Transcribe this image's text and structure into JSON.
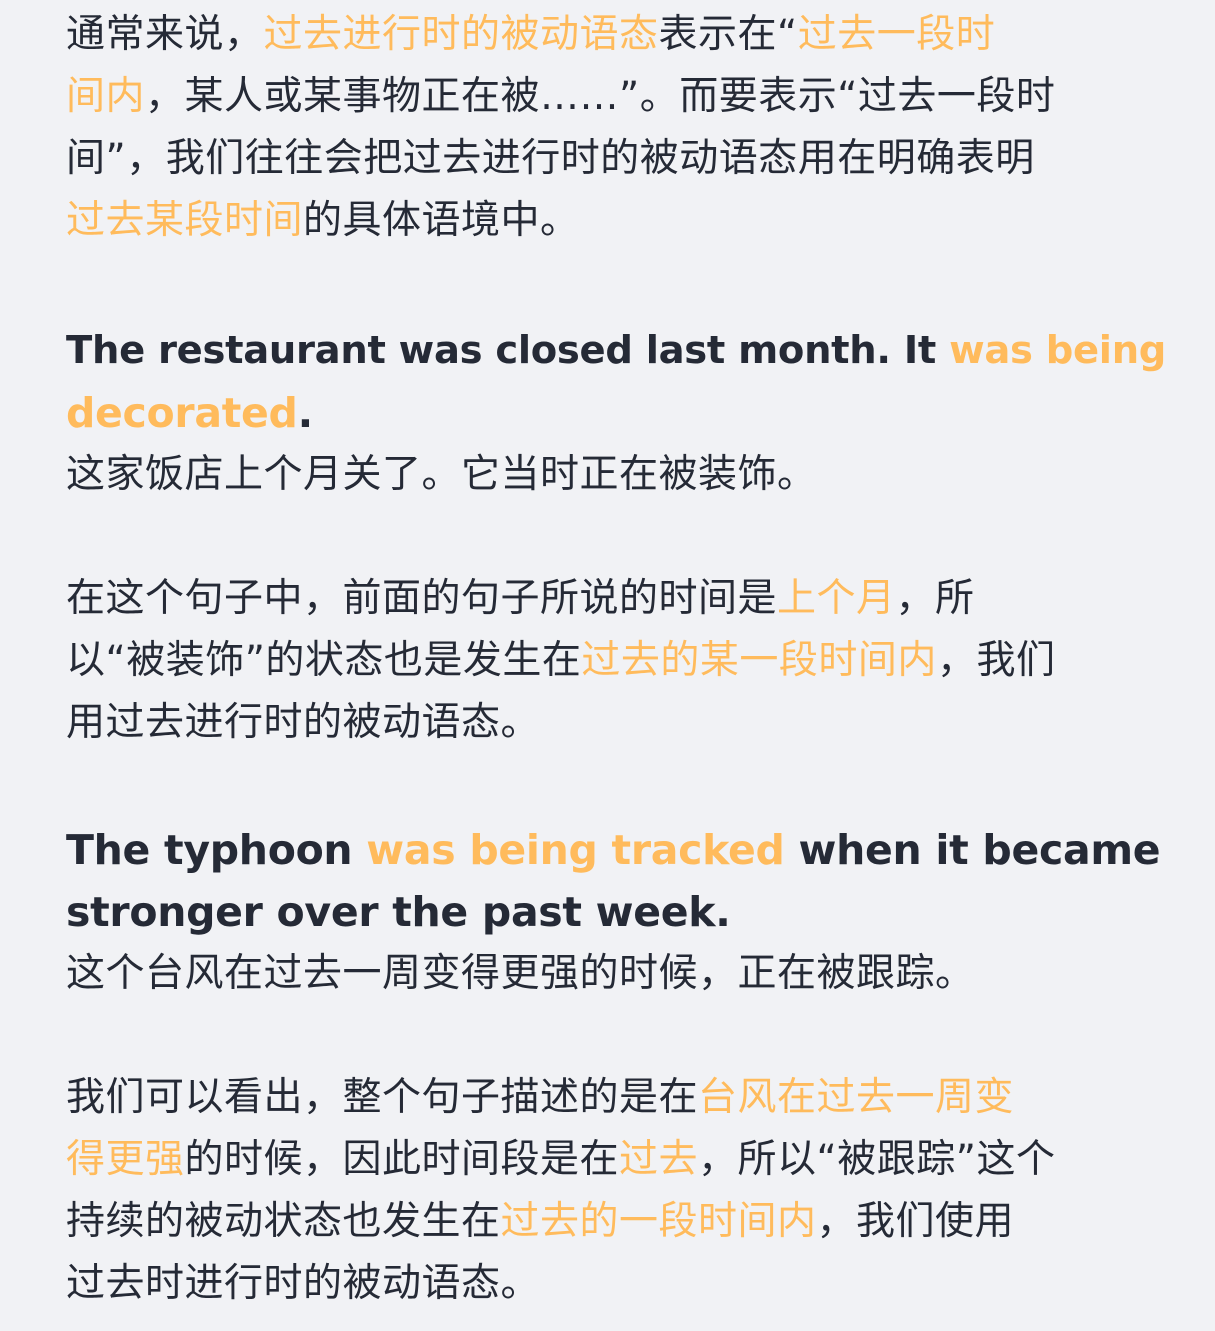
{
  "paragraphs": [
    {
      "type": "explanation",
      "lines": [
        [
          {
            "text": "通常来说，",
            "highlight": false
          },
          {
            "text": "过去进行时的被动语态",
            "highlight": true
          },
          {
            "text": "表示在“",
            "highlight": false
          },
          {
            "text": "过去一段时",
            "highlight": true
          }
        ],
        [
          {
            "text": "间内",
            "highlight": true
          },
          {
            "text": "，某人或某事物正在被……”。而要表示“过去一段时",
            "highlight": false
          }
        ],
        [
          {
            "text": "间”，我们往往会把过去进行时的被动语态用在明确表明",
            "highlight": false
          }
        ],
        [
          {
            "text": "过去某段时间",
            "highlight": true
          },
          {
            "text": "的具体语境中。",
            "highlight": false
          }
        ]
      ]
    },
    {
      "type": "example",
      "lines": [
        [
          {
            "text": "The restaurant was closed last month. It ",
            "highlight": false
          },
          {
            "text": "was being",
            "highlight": true
          }
        ],
        [
          {
            "text": "decorated",
            "highlight": true
          },
          {
            "text": ".",
            "highlight": false
          }
        ]
      ],
      "translation": "这家饭店上个月关了。它当时正在被装饰。"
    },
    {
      "type": "explanation",
      "lines": [
        [
          {
            "text": "在这个句子中，前面的句子所说的时间是",
            "highlight": false
          },
          {
            "text": "上个月",
            "highlight": true
          },
          {
            "text": "，所",
            "highlight": false
          }
        ],
        [
          {
            "text": "以“被装饰”的状态也是发生在",
            "highlight": false
          },
          {
            "text": "过去的某一段时间内",
            "highlight": true
          },
          {
            "text": "，我们",
            "highlight": false
          }
        ],
        [
          {
            "text": "用过去进行时的被动语态。",
            "highlight": false
          }
        ]
      ]
    },
    {
      "type": "example",
      "lines": [
        [
          {
            "text": "The typhoon ",
            "highlight": false
          },
          {
            "text": "was being tracked",
            "highlight": true
          },
          {
            "text": " when it became",
            "highlight": false
          }
        ],
        [
          {
            "text": "stronger over the past week.",
            "highlight": false
          }
        ]
      ],
      "translation": "这个台风在过去一周变得更强的时候，正在被跟踪。"
    },
    {
      "type": "explanation",
      "lines": [
        [
          {
            "text": "我们可以看出，整个句子描述的是在",
            "highlight": false
          },
          {
            "text": "台风在过去一周变",
            "highlight": true
          }
        ],
        [
          {
            "text": "得更强",
            "highlight": true
          },
          {
            "text": "的时候，因此时间段是在",
            "highlight": false
          },
          {
            "text": "过去",
            "highlight": true
          },
          {
            "text": "，所以“被跟踪”这个",
            "highlight": false
          }
        ],
        [
          {
            "text": "持续的被动状态也发生在",
            "highlight": false
          },
          {
            "text": "过去的一段时间内",
            "highlight": true
          },
          {
            "text": "，我们使用",
            "highlight": false
          }
        ],
        [
          {
            "text": "过去时进行时的被动语态。",
            "highlight": false
          }
        ]
      ]
    }
  ],
  "colors": {
    "text": "#252a36",
    "highlight": "#ffbb5c",
    "background": "#f1f2f5"
  }
}
